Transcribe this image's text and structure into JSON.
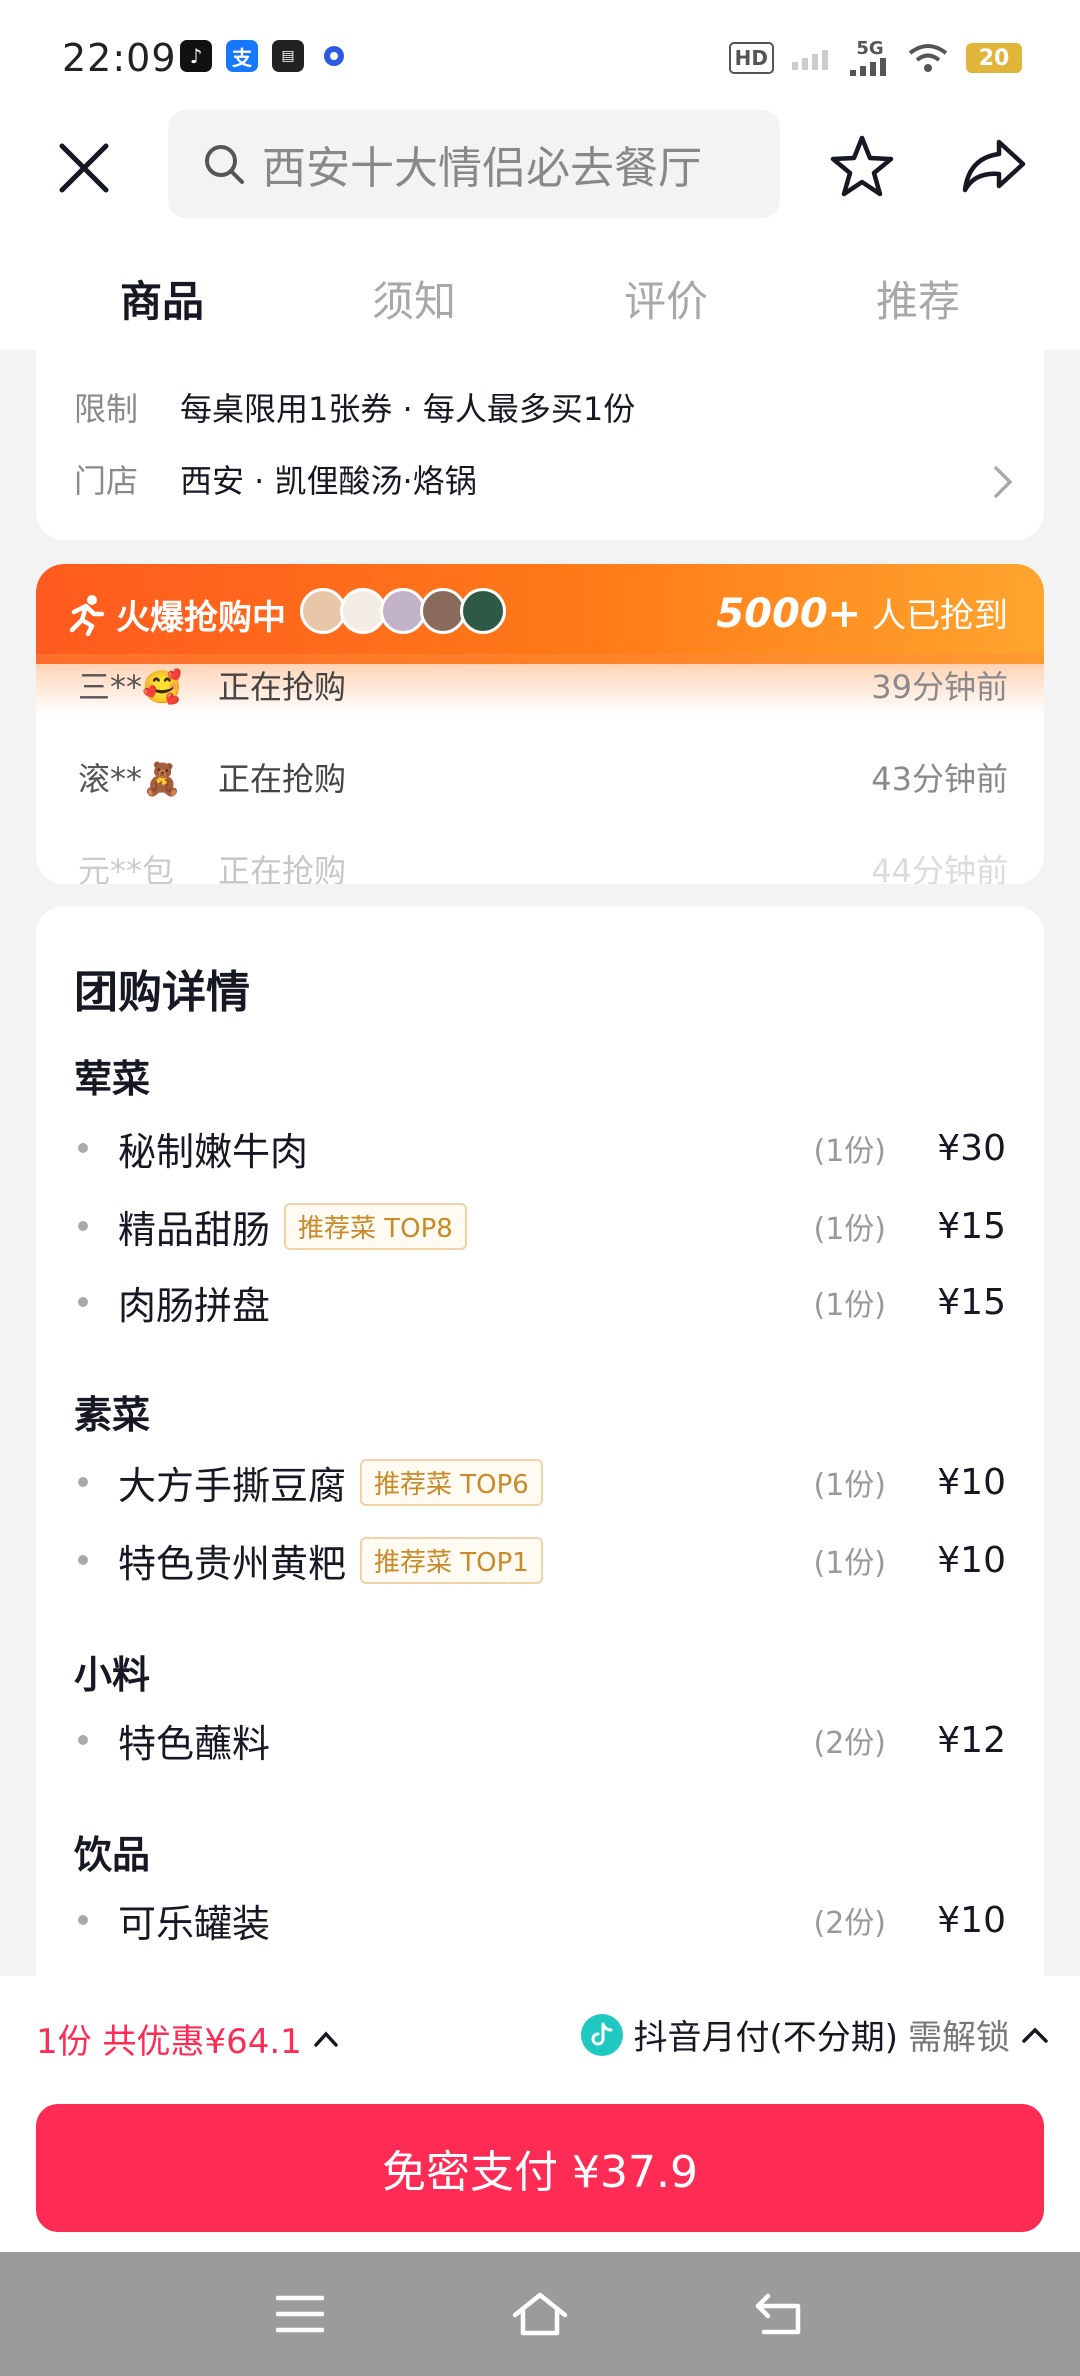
{
  "status_bar": {
    "time": "22:09",
    "hd_label": "HD",
    "network": "5G",
    "battery": "20"
  },
  "header": {
    "search_text": "西安十大情侣必去餐厅"
  },
  "tabs": [
    {
      "label": "商品",
      "active": true
    },
    {
      "label": "须知",
      "active": false
    },
    {
      "label": "评价",
      "active": false
    },
    {
      "label": "推荐",
      "active": false
    }
  ],
  "info": {
    "limit_label": "限制",
    "limit_value": "每桌限用1张券 · 每人最多买1份",
    "store_label": "门店",
    "store_value": "西安 · 凯俚酸汤·烙锅"
  },
  "hot": {
    "title": "火爆抢购中",
    "count_num": "5000+",
    "count_text": " 人已抢到",
    "buyers": [
      {
        "name": "三**🥰",
        "status": "正在抢购",
        "time": "39分钟前"
      },
      {
        "name": "滚**🧸",
        "status": "正在抢购",
        "time": "43分钟前"
      },
      {
        "name": "元**包",
        "status": "正在抢购",
        "time": "44分钟前"
      }
    ]
  },
  "detail": {
    "title": "团购详情",
    "sections": [
      {
        "title": "荤菜",
        "items": [
          {
            "name": "秘制嫩牛肉",
            "tag": "",
            "qty": "(1份)",
            "price": "¥30"
          },
          {
            "name": "精品甜肠",
            "tag": "推荐菜 TOP8",
            "qty": "(1份)",
            "price": "¥15"
          },
          {
            "name": "肉肠拼盘",
            "tag": "",
            "qty": "(1份)",
            "price": "¥15"
          }
        ]
      },
      {
        "title": "素菜",
        "items": [
          {
            "name": "大方手撕豆腐",
            "tag": "推荐菜 TOP6",
            "qty": "(1份)",
            "price": "¥10"
          },
          {
            "name": "特色贵州黄粑",
            "tag": "推荐菜 TOP1",
            "qty": "(1份)",
            "price": "¥10"
          }
        ]
      },
      {
        "title": "小料",
        "items": [
          {
            "name": "特色蘸料",
            "tag": "",
            "qty": "(2份)",
            "price": "¥12"
          }
        ]
      },
      {
        "title": "饮品",
        "items": [
          {
            "name": "可乐罐装",
            "tag": "",
            "qty": "(2份)",
            "price": "¥10"
          }
        ]
      }
    ]
  },
  "bottom": {
    "discount": "1份 共优惠¥64.1",
    "pay_method": "抖音月付(不分期)",
    "unlock": "需解锁",
    "pay_button": "免密支付 ¥37.9"
  },
  "colors": {
    "brand": "#fe2c55",
    "hot_orange": "#ff7a18",
    "tag_gold": "#c98a2a"
  }
}
